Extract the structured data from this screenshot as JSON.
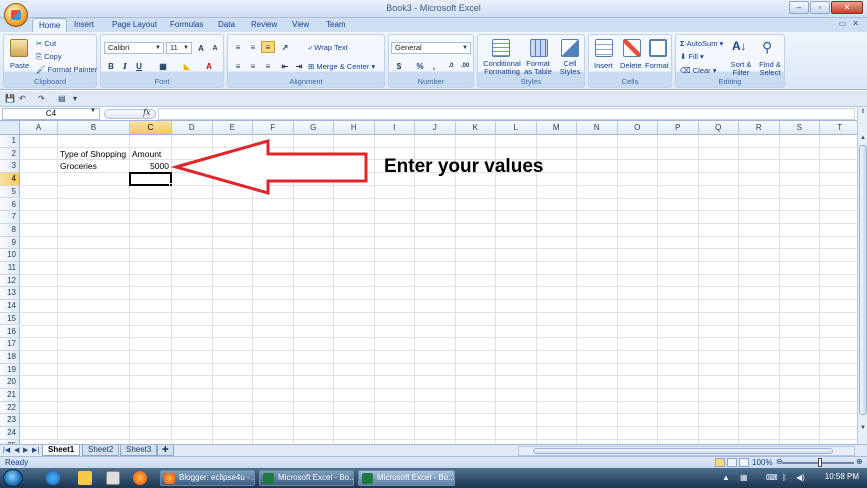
{
  "window": {
    "title": "Book3 - Microsoft Excel",
    "buttons": [
      "–",
      "▫",
      "✕"
    ]
  },
  "ribbon_tabs": [
    "Home",
    "Insert",
    "Page Layout",
    "Formulas",
    "Data",
    "Review",
    "View",
    "Team"
  ],
  "ribbon": {
    "clipboard": {
      "label": "Clipboard",
      "paste": "Paste",
      "cut": "Cut",
      "copy": "Copy",
      "format_painter": "Format Painter"
    },
    "font": {
      "label": "Font",
      "family": "Calibri",
      "size": "11",
      "bold": "B",
      "italic": "I",
      "underline": "U"
    },
    "alignment": {
      "label": "Alignment",
      "wrap_text": "Wrap Text",
      "merge_center": "Merge & Center"
    },
    "number": {
      "label": "Number",
      "format": "General",
      "currency": "$",
      "percent": "%",
      "comma": ","
    },
    "styles": {
      "label": "Styles",
      "conditional_formatting": "Conditional Formatting",
      "format_as_table": "Format as Table",
      "cell_styles": "Cell Styles"
    },
    "cells": {
      "label": "Cells",
      "insert": "Insert",
      "delete": "Delete",
      "format": "Format"
    },
    "editing": {
      "label": "Editing",
      "autosum": "AutoSum",
      "fill": "Fill",
      "clear": "Clear",
      "sort_filter": "Sort & Filter",
      "find_select": "Find & Select"
    }
  },
  "formula_bar": {
    "name_box": "C4",
    "fx": "fx",
    "content": ""
  },
  "columns": [
    "A",
    "B",
    "C",
    "D",
    "E",
    "F",
    "G",
    "H",
    "I",
    "J",
    "K",
    "L",
    "M",
    "N",
    "O",
    "P",
    "Q",
    "R",
    "S",
    "T"
  ],
  "rows": [
    "1",
    "2",
    "3",
    "4",
    "5",
    "6",
    "7",
    "8",
    "9",
    "10",
    "11",
    "12",
    "13",
    "14",
    "15",
    "16",
    "17",
    "18",
    "19",
    "20",
    "21",
    "22",
    "23",
    "24",
    "25"
  ],
  "selected": {
    "column": "C",
    "row": "4"
  },
  "cells": {
    "B2": "Type of Shopping",
    "C2": "Amount",
    "B3": "Groceries",
    "C3": "5000"
  },
  "callout": {
    "text": "Enter your values",
    "arrow_color": "#e0262b"
  },
  "sheets": [
    "Sheet1",
    "Sheet2",
    "Sheet3"
  ],
  "active_sheet": "Sheet1",
  "status": {
    "text": "Ready",
    "zoom": "100%"
  },
  "taskbar": {
    "tasks": [
      "Blogger: eclipse4u - ...",
      "Microsoft Excel - Bo...",
      "Microsoft Excel - Bo..."
    ],
    "clock": "10:58 PM"
  },
  "colors": {
    "accent": "#15428b",
    "ribbon_bg": "#dbe7f6",
    "selection": "#f8c65c"
  }
}
